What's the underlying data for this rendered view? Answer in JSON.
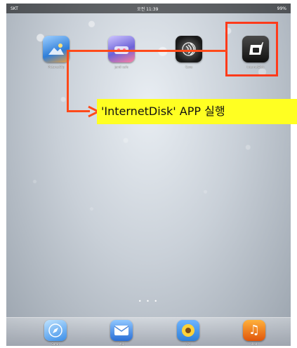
{
  "status_bar": {
    "carrier": "SKT",
    "time": "오전 11:39",
    "battery": "99%"
  },
  "home_apps": [
    {
      "name": "PicturesClip"
    },
    {
      "name": "jandi cafe"
    },
    {
      "name": "Cava"
    },
    {
      "name": "InternetDisk"
    }
  ],
  "callout": {
    "text": "'InternetDisk' APP 실행"
  },
  "dock_apps": [
    {
      "name": "Safari"
    },
    {
      "name": "Mail"
    },
    {
      "name": "사진"
    },
    {
      "name": "iPod"
    }
  ],
  "colors": {
    "highlight": "#ff3a1a",
    "arrow": "#ff4a1a",
    "callout_bg": "#ffff22"
  },
  "icons": {
    "photo": "landscape-icon",
    "jandi": "app-icon",
    "cava": "speaker-icon",
    "disk": "internetdisk-d-icon",
    "safari": "compass-icon",
    "mail": "envelope-icon",
    "photos": "sunflower-icon",
    "ipod": "music-note-icon"
  }
}
